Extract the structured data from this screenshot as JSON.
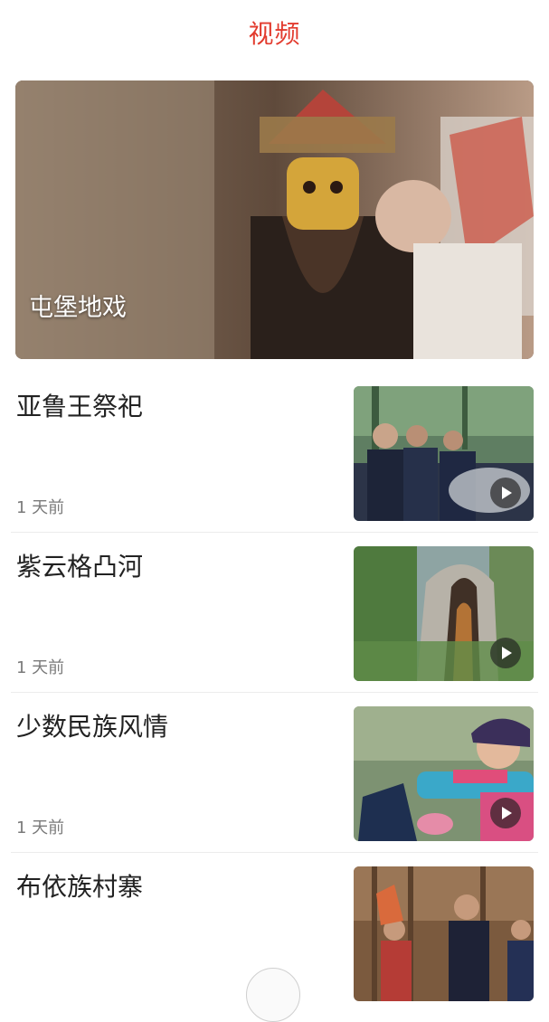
{
  "header": {
    "title": "视频"
  },
  "hero": {
    "title": "屯堡地戏"
  },
  "videos": [
    {
      "title": "亚鲁王祭祀",
      "time": "1 天前"
    },
    {
      "title": "紫云格凸河",
      "time": "1 天前"
    },
    {
      "title": "少数民族风情",
      "time": "1 天前"
    },
    {
      "title": "布依族村寨",
      "time": ""
    }
  ]
}
